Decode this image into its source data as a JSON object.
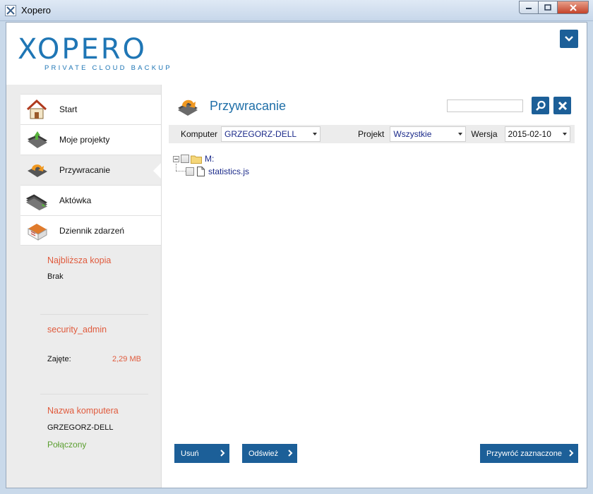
{
  "window": {
    "title": "Xopero"
  },
  "header": {
    "logo_text": "XOPERO",
    "logo_subtitle": "PRIVATE CLOUD BACKUP"
  },
  "sidebar": {
    "items": [
      {
        "label": "Start",
        "icon": "home-icon"
      },
      {
        "label": "Moje projekty",
        "icon": "projects-icon"
      },
      {
        "label": "Przywracanie",
        "icon": "restore-icon",
        "active": true
      },
      {
        "label": "Aktówka",
        "icon": "briefcase-icon"
      },
      {
        "label": "Dziennik zdarzeń",
        "icon": "event-log-icon"
      }
    ],
    "nearest_copy": {
      "heading": "Najbliższa kopia",
      "value": "Brak"
    },
    "user": {
      "name": "security_admin",
      "used_label": "Zajęte:",
      "used_value": "2,29 MB"
    },
    "computer": {
      "heading": "Nazwa komputera",
      "name": "GRZEGORZ-DELL",
      "status": "Połączony"
    }
  },
  "main": {
    "title": "Przywracanie",
    "search": {
      "value": "",
      "placeholder": ""
    },
    "filters": {
      "computer_label": "Komputer",
      "computer_value": "GRZEGORZ-DELL",
      "project_label": "Projekt",
      "project_value": "Wszystkie",
      "version_label": "Wersja",
      "version_value": "2015-02-10"
    },
    "tree": {
      "root": {
        "label": "M:",
        "checked": false,
        "expanded": true
      },
      "children": [
        {
          "label": "statistics.js",
          "checked": false
        }
      ]
    },
    "buttons": {
      "delete": "Usuń",
      "refresh": "Odśwież",
      "restore_selected": "Przywróć zaznaczone"
    }
  },
  "colors": {
    "accent_blue": "#1c5f98",
    "title_blue": "#1f6fa8",
    "heading_orange": "#e05a3c",
    "status_green": "#5a9e2f"
  }
}
